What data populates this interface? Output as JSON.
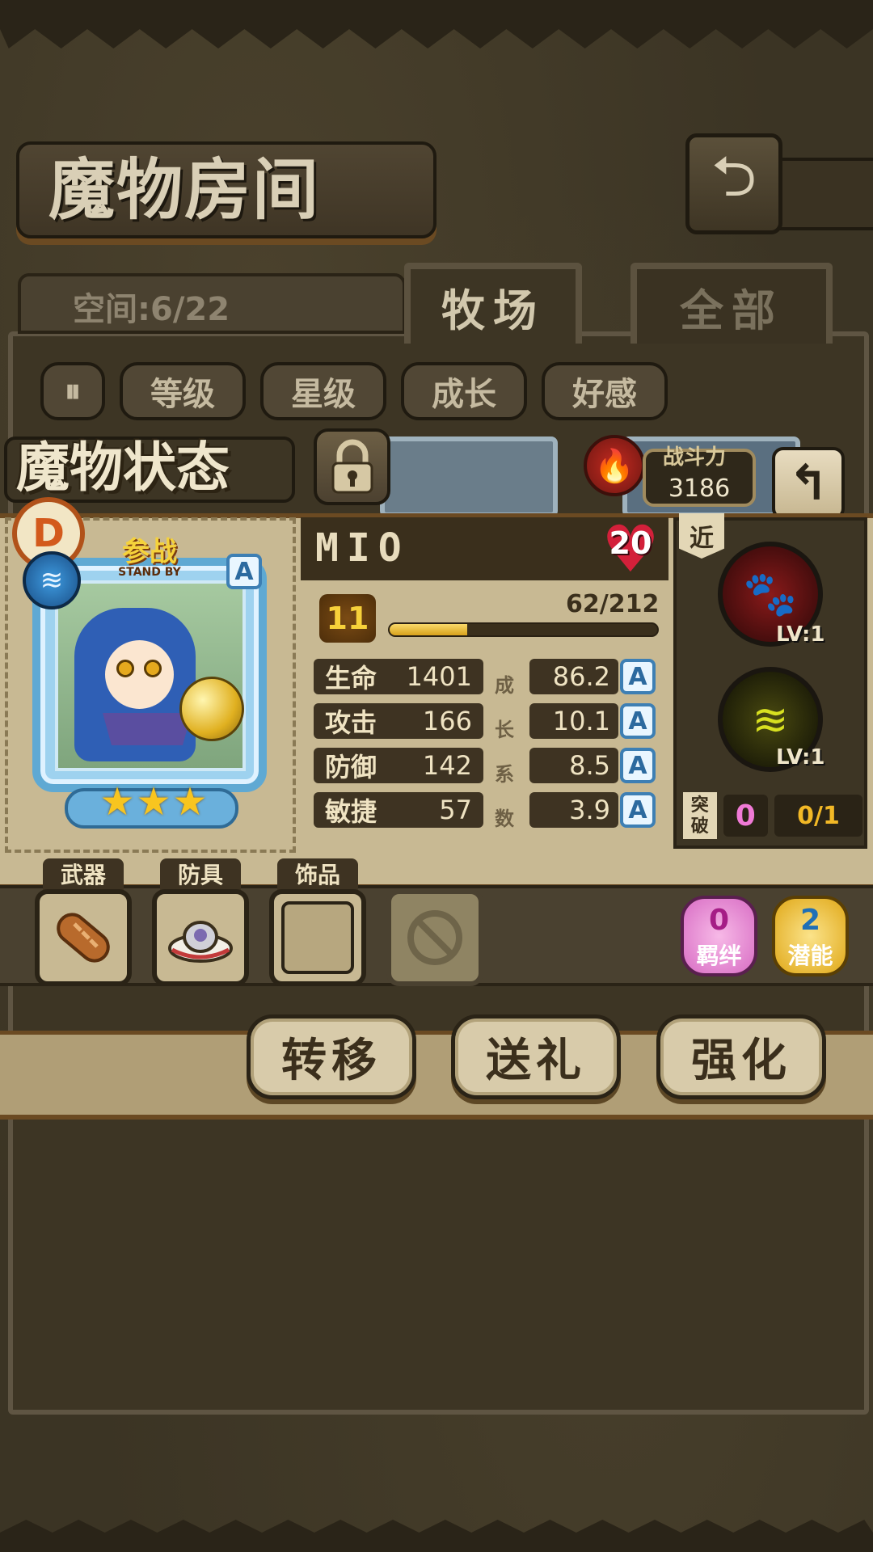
{
  "header": {
    "title": "魔物房间",
    "back_icon": "return-arrow-icon"
  },
  "storage": {
    "space_label": "空间:6/22"
  },
  "tabs": [
    {
      "label": "牧场",
      "active": true
    },
    {
      "label": "全部",
      "active": false
    }
  ],
  "filters": {
    "toggle_icon": "sort-toggle-icon",
    "items": [
      "等级",
      "星级",
      "成长",
      "好感"
    ]
  },
  "status": {
    "title": "魔物状态",
    "lock_icon": "padlock-icon",
    "power_label": "战斗力",
    "power_value": "3186",
    "fire_icon": "fire-element-icon"
  },
  "monster": {
    "name": "MIO",
    "affection": "20",
    "level": "11",
    "exp_text": "62/212",
    "exp_fraction": 0.29,
    "standby_main": "参战",
    "standby_sub": "STAND BY",
    "rank": "A",
    "stars": 3,
    "element": "water",
    "stats": [
      {
        "name": "生命",
        "value": "1401",
        "growth": "86.2",
        "grade": "A"
      },
      {
        "name": "攻击",
        "value": "166",
        "growth": "10.1",
        "grade": "A"
      },
      {
        "name": "防御",
        "value": "142",
        "growth": "8.5",
        "grade": "A"
      },
      {
        "name": "敏捷",
        "value": "57",
        "growth": "3.9",
        "grade": "A"
      }
    ],
    "growth_label_chars": [
      "成",
      "长",
      "系",
      "数"
    ]
  },
  "skills": {
    "tag": "近",
    "items": [
      {
        "icon": "paw-claw-icon",
        "level": "LV:1"
      },
      {
        "icon": "lightning-slash-icon",
        "level": "LV:1"
      }
    ],
    "breakthrough_label": "突破",
    "breakthrough_count": "0",
    "breakthrough_progress": "0/1"
  },
  "equipment": {
    "slots": [
      {
        "label": "武器",
        "item_icon": "bread-icon"
      },
      {
        "label": "防具",
        "item_icon": "hat-icon"
      },
      {
        "label": "饰品",
        "item_icon": ""
      },
      {
        "label": "",
        "item_icon": "locked-slot-icon"
      }
    ],
    "bond": {
      "count": "0",
      "label": "羁绊"
    },
    "potential": {
      "count": "2",
      "label": "潜能"
    }
  },
  "actions": [
    "转移",
    "送礼",
    "强化"
  ],
  "colors": {
    "parchment": "#c8b993",
    "dark_wood": "#3d3524",
    "gold": "#f2b826",
    "water_blue": "#5fa9d3"
  }
}
